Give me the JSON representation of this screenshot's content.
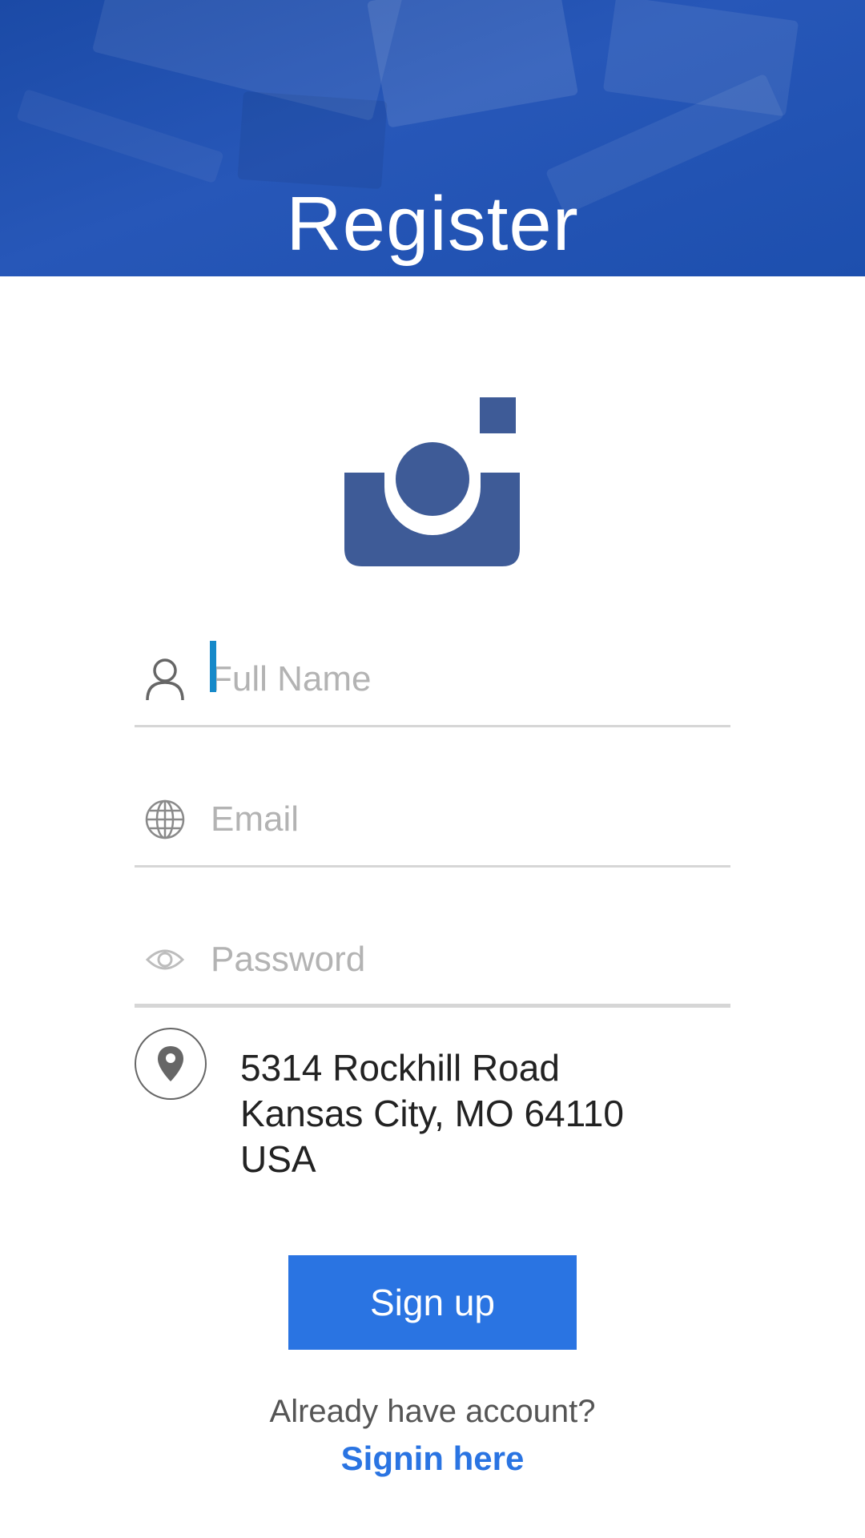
{
  "header": {
    "title": "Register"
  },
  "logo": {
    "icon": "camera-icon",
    "color": "#3e5b97"
  },
  "form": {
    "full_name": {
      "placeholder": "Full Name",
      "value": "",
      "icon": "user-icon"
    },
    "email": {
      "placeholder": "Email",
      "value": "",
      "icon": "globe-icon"
    },
    "password": {
      "placeholder": "Password",
      "value": "",
      "icon": "eye-icon"
    }
  },
  "address": {
    "icon": "map-pin-icon",
    "line1": "5314 Rockhill Road",
    "line2": "Kansas City, MO 64110",
    "line3": "USA"
  },
  "actions": {
    "signup_label": "Sign up",
    "already_text": "Already have account?",
    "signin_label": "Signin here"
  },
  "colors": {
    "header_blue": "#1d4fae",
    "button_blue": "#2a74e2",
    "link_blue": "#2a74e2",
    "caret_blue": "#1689c9"
  }
}
